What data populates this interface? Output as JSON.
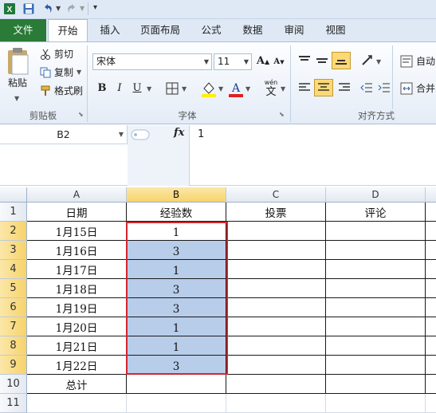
{
  "qat": {
    "icons": [
      "excel-icon",
      "save-icon",
      "undo-icon",
      "redo-icon",
      "customize-icon"
    ]
  },
  "tabs": [
    "文件",
    "开始",
    "插入",
    "页面布局",
    "公式",
    "数据",
    "审阅",
    "视图"
  ],
  "ribbon": {
    "clipboard": {
      "paste": "粘贴",
      "cut": "剪切",
      "copy": "复制",
      "format_painter": "格式刷",
      "group": "剪贴板"
    },
    "font": {
      "name": "宋体",
      "size": "11",
      "bold": "B",
      "italic": "I",
      "underline": "U",
      "group": "字体",
      "wen": "wén",
      "wen_char": "文"
    },
    "align": {
      "wrap": "自动",
      "merge": "合并",
      "group": "对齐方式"
    }
  },
  "formula_bar": {
    "name_box": "B2",
    "fx": "fx",
    "value": "1"
  },
  "columns": [
    "A",
    "B",
    "C",
    "D"
  ],
  "rows": [
    "1",
    "2",
    "3",
    "4",
    "5",
    "6",
    "7",
    "8",
    "9",
    "10",
    "11"
  ],
  "table": {
    "headers": [
      "日期",
      "经验数",
      "投票",
      "评论"
    ],
    "dates": [
      "1月15日",
      "1月16日",
      "1月17日",
      "1月18日",
      "1月19日",
      "1月20日",
      "1月21日",
      "1月22日"
    ],
    "experience": [
      "1",
      "3",
      "1",
      "3",
      "3",
      "1",
      "1",
      "3"
    ],
    "total_label": "总计"
  },
  "colors": {
    "file_tab": "#2a7a38",
    "selection_border": "#d1272e",
    "selection_fill": "#b8cde9",
    "header_selected": "#f7d36a"
  }
}
